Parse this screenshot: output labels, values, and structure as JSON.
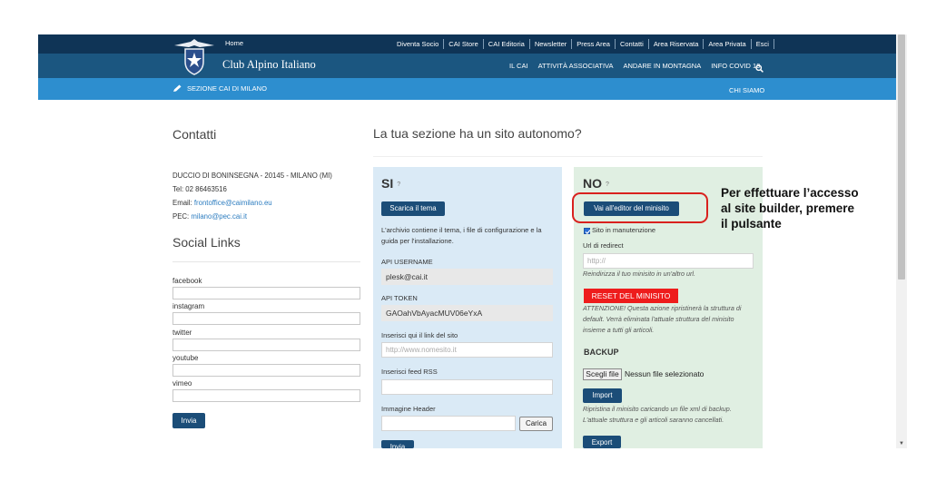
{
  "colors": {
    "top_bar": "#0f3456",
    "main_bar": "#1b5680",
    "sub_bar": "#2d8ecf",
    "button_dark": "#1b4d78",
    "reset_red": "#ee1c1c",
    "highlight_ring": "#d9211e",
    "panel_si_bg": "#daeaf6",
    "panel_no_bg": "#e0efe2"
  },
  "header": {
    "home_label": "Home",
    "brand": "Club Alpino Italiano",
    "top_nav": [
      "Diventa Socio",
      "CAI Store",
      "CAI Editoria",
      "Newsletter",
      "Press Area",
      "Contatti",
      "Area Riservata",
      "Area Privata",
      "Esci"
    ],
    "main_nav": [
      "IL CAI",
      "ATTIVITÀ ASSOCIATIVA",
      "ANDARE IN MONTAGNA",
      "INFO COVID 19"
    ],
    "search_icon": "search-icon",
    "section_icon": "pencil-icon",
    "section_label": "SEZIONE CAI DI MILANO",
    "chi_siamo": "CHI SIAMO"
  },
  "contatti": {
    "title": "Contatti",
    "address": "DUCCIO DI BONINSEGNA - 20145 - MILANO (MI)",
    "tel": "Tel: 02 86463516",
    "email_prefix": "Email: ",
    "email": "frontoffice@caimilano.eu",
    "pec_prefix": "PEC: ",
    "pec": "milano@pec.cai.it"
  },
  "social": {
    "title": "Social Links",
    "fields": [
      "facebook",
      "instagram",
      "twitter",
      "youtube",
      "vimeo"
    ],
    "submit_label": "Invia"
  },
  "main": {
    "title": "La tua sezione ha un sito autonomo?"
  },
  "si_panel": {
    "heading": "SI",
    "help": "?",
    "download_label": "Scarica il tema",
    "description_line1": "L'archivio contiene il tema, i file di configurazione e la",
    "description_line2": "guida per l'installazione.",
    "api_username_label": "API USERNAME",
    "api_username_value": "plesk@cai.it",
    "api_token_label": "API TOKEN",
    "api_token_value": "GAOahVbAyacMUV06eYxA",
    "site_link_label": "Inserisci qui il link del sito",
    "site_link_placeholder": "http://www.nomesito.it",
    "rss_label": "Inserisci feed RSS",
    "header_image_label": "Immagine Header",
    "upload_label": "Carica",
    "submit_label": "Invia"
  },
  "no_panel": {
    "heading": "NO",
    "help": "?",
    "editor_label": "Vai all'editor del minisito",
    "maintenance_label": "Sito in manutenzione",
    "maintenance_checked": true,
    "redirect_label": "Url di redirect",
    "redirect_placeholder": "http://",
    "redirect_hint": "Reindirizza il tuo minisito in un'altro url.",
    "reset_label": "RESET DEL MINISITO",
    "warning_line1": "ATTENZIONE! Questa azione ripristinerà la struttura di",
    "warning_line2": "default. Verrà eliminata l'attuale struttura del minisito",
    "warning_line3": "insieme a tutti gli articoli.",
    "backup_label": "BACKUP",
    "file_button": "Scegli file",
    "file_status": "Nessun file selezionato",
    "import_label": "Import",
    "import_hint_line1": "Ripristina il minisito caricando un file xml di backup.",
    "import_hint_line2": "L'attuale struttura e gli articoli saranno cancellati.",
    "export_label": "Export"
  },
  "callout": {
    "line1": "Per effettuare l’accesso",
    "line2": "al site builder, premere",
    "line3": "il pulsante"
  }
}
